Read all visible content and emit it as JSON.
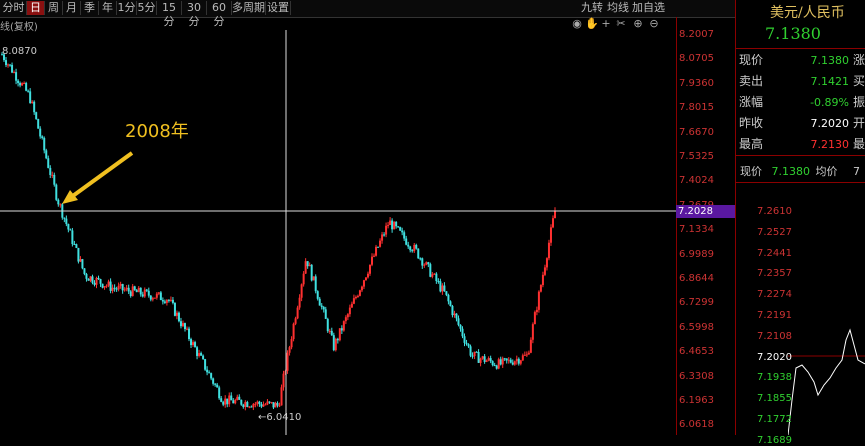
{
  "toolbar": {
    "periods": [
      {
        "label": "分时",
        "active": false
      },
      {
        "label": "日",
        "active": true
      },
      {
        "label": "周",
        "active": false
      },
      {
        "label": "月",
        "active": false
      },
      {
        "label": "季",
        "active": false
      },
      {
        "label": "年",
        "active": false
      },
      {
        "label": "1分",
        "active": false
      },
      {
        "label": "5分",
        "active": false
      },
      {
        "label": "15分",
        "active": false
      },
      {
        "label": "30分",
        "active": false
      },
      {
        "label": "60分",
        "active": false
      },
      {
        "label": "多周期",
        "active": false
      },
      {
        "label": "设置",
        "active": false
      }
    ],
    "right_buttons": [
      "九转",
      "均线",
      "加自选"
    ],
    "icons": [
      "eye-icon",
      "hand-icon",
      "crosshair-icon",
      "scissors-icon",
      "zoom-in-icon",
      "zoom-out-icon"
    ]
  },
  "sub_label": "线(复权)",
  "chart": {
    "annotation": "2008年",
    "high_label": "8.0870",
    "low_label": "6.0410",
    "current_tag": "7.2028",
    "price_ticks": [
      "8.2007",
      "8.0705",
      "7.9360",
      "7.8015",
      "7.6670",
      "7.5325",
      "7.4024",
      "7.2679",
      "7.1334",
      "6.9989",
      "6.8644",
      "6.7299",
      "6.5998",
      "6.4653",
      "6.3308",
      "6.1963",
      "6.0618"
    ],
    "colors": {
      "up": "#ff3030",
      "down": "#40e0e0",
      "annotation": "#f0c020",
      "crosshair": "#ffffff"
    }
  },
  "chart_data": {
    "type": "line",
    "title": "",
    "x": [
      0,
      0.05,
      0.1,
      0.15,
      0.2,
      0.3,
      0.4,
      0.5,
      0.55,
      0.6,
      0.65,
      0.7,
      0.75,
      0.8,
      0.85,
      0.9,
      0.95,
      1.0
    ],
    "values": [
      8.087,
      7.85,
      7.28,
      6.85,
      6.78,
      6.72,
      6.15,
      6.12,
      6.95,
      6.45,
      6.8,
      7.15,
      6.98,
      6.75,
      6.4,
      6.35,
      6.4,
      7.21
    ],
    "ylim": [
      6.0,
      8.2
    ]
  },
  "panel": {
    "title": "美元/人民币",
    "price": "7.1380",
    "quotes": [
      {
        "label": "现价",
        "value": "7.1380",
        "color": "#30d030",
        "suffix": "涨"
      },
      {
        "label": "卖出",
        "value": "7.1421",
        "color": "#30d030",
        "suffix": "买"
      },
      {
        "label": "涨幅",
        "value": "-0.89%",
        "color": "#30d030",
        "suffix": "振"
      },
      {
        "label": "昨收",
        "value": "7.2020",
        "color": "#ffffff",
        "suffix": "开"
      },
      {
        "label": "最高",
        "value": "7.2130",
        "color": "#ff3030",
        "suffix": "最"
      }
    ],
    "mini_header": {
      "label1": "现价",
      "value": "7.1380",
      "label2": "均价",
      "extra": "7"
    },
    "mini_ticks": [
      "7.2610",
      "7.2527",
      "7.2441",
      "7.2357",
      "7.2274",
      "7.2191",
      "7.2108",
      "7.2020",
      "7.1938",
      "7.1855",
      "7.1772",
      "7.1689"
    ]
  }
}
